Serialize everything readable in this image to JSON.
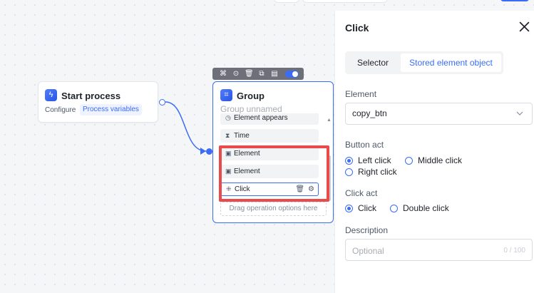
{
  "nodes": {
    "start": {
      "title": "Start process",
      "configure": "Configure",
      "link": "Process variables"
    },
    "group": {
      "title": "Group",
      "subtitle": "Group unnamed",
      "items": [
        {
          "label": "Element appears",
          "icon": "clock-icon"
        },
        {
          "label": "Time",
          "icon": "hourglass-icon"
        },
        {
          "label": "Element",
          "icon": "element-icon"
        },
        {
          "label": "Element",
          "icon": "element-icon"
        },
        {
          "label": "Click",
          "icon": "click-icon"
        }
      ],
      "drop_hint": "Drag operation options here"
    }
  },
  "panel": {
    "title": "Click",
    "tabs": {
      "selector": "Selector",
      "stored": "Stored element object"
    },
    "element": {
      "label": "Element",
      "value": "copy_btn"
    },
    "button_act": {
      "label": "Button act",
      "left": "Left click",
      "middle": "Middle click",
      "right": "Right click",
      "selected": "Left click"
    },
    "click_act": {
      "label": "Click act",
      "click": "Click",
      "double": "Double click",
      "selected": "Click"
    },
    "description": {
      "label": "Description",
      "placeholder": "Optional",
      "counter": "0 / 100"
    }
  },
  "colors": {
    "accent": "#3b6cf6",
    "highlight": "#e94b4b"
  }
}
